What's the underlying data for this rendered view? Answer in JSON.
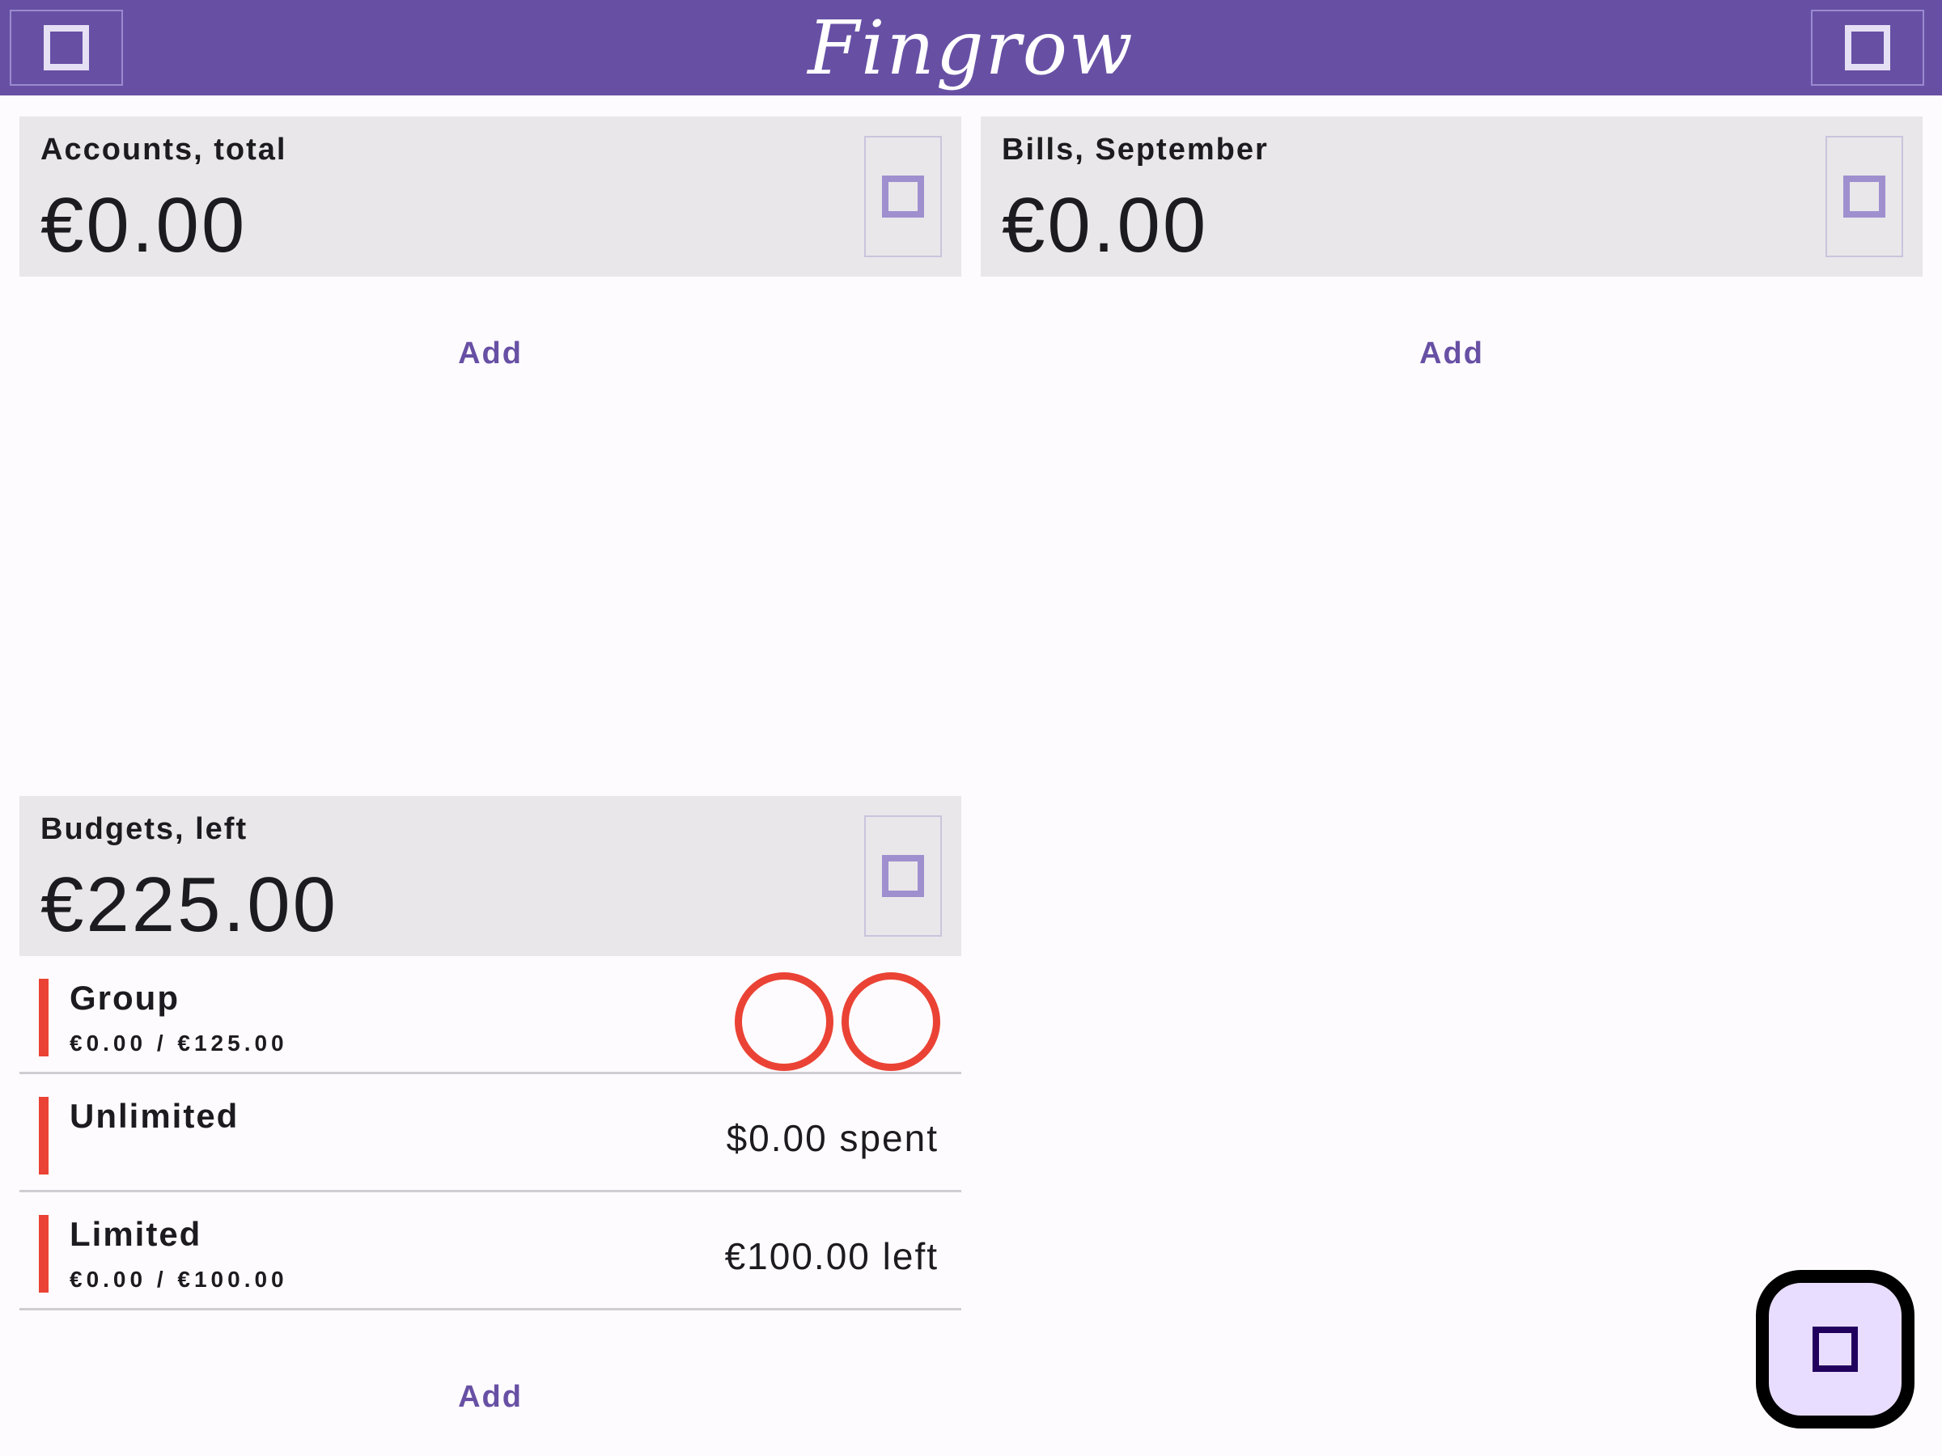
{
  "app": {
    "logo_text": "Fingrow",
    "menu_icon": "menu-icon",
    "action_icon": "settings-icon"
  },
  "accounts": {
    "title": "Accounts, total",
    "amount": "€0.00",
    "add_label": "Add",
    "icon": "chevron-icon"
  },
  "bills": {
    "title": "Bills, September",
    "amount": "€0.00",
    "add_label": "Add",
    "icon": "chevron-icon"
  },
  "budgets": {
    "title": "Budgets, left",
    "amount": "€225.00",
    "add_label": "Add",
    "icon": "chevron-icon",
    "items": [
      {
        "name": "Group",
        "subtitle": "€0.00 / €125.00",
        "right": "",
        "progress": [
          0,
          0
        ]
      },
      {
        "name": "Unlimited",
        "subtitle": "",
        "right": "$0.00 spent"
      },
      {
        "name": "Limited",
        "subtitle": "€0.00 / €100.00",
        "right": "€100.00 left"
      }
    ]
  },
  "fab": {
    "icon": "add-icon"
  },
  "colors": {
    "primary": "#6750a4",
    "surface": "#e9e7ea",
    "budget_accent": "#ea4335",
    "fab_bg": "#e9ddff"
  }
}
